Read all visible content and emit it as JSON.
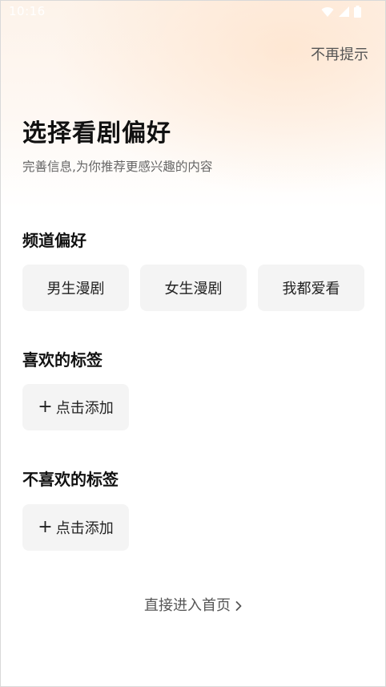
{
  "status_bar": {
    "time": "10:16",
    "icons": [
      "wifi-icon",
      "signal-icon",
      "battery-icon"
    ]
  },
  "skip_label": "不再提示",
  "header": {
    "title": "选择看剧偏好",
    "subtitle": "完善信息,为你推荐更感兴趣的内容"
  },
  "channel": {
    "title": "频道偏好",
    "options": [
      "男生漫剧",
      "女生漫剧",
      "我都爱看"
    ]
  },
  "liked_tags": {
    "title": "喜欢的标签",
    "add_label": "点击添加"
  },
  "disliked_tags": {
    "title": "不喜欢的标签",
    "add_label": "点击添加"
  },
  "enter_home_label": "直接进入首页",
  "colors": {
    "chip_bg": "#f4f4f4",
    "text_primary": "#111111",
    "text_secondary": "#666666",
    "header_gradient": "#fdf3ea"
  }
}
